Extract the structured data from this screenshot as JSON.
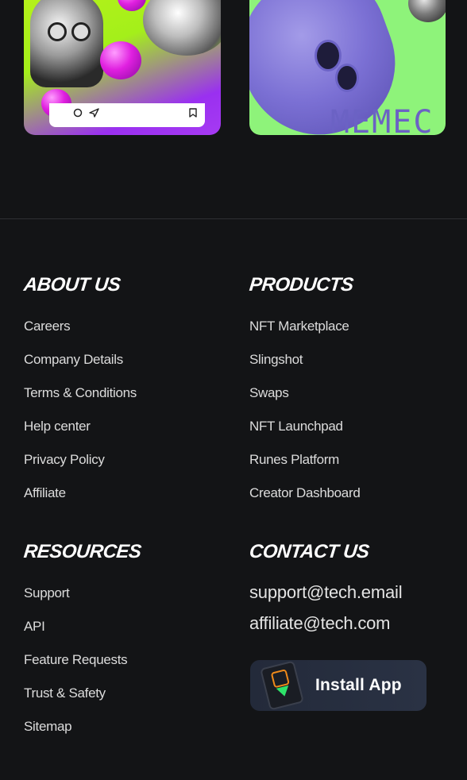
{
  "cards": {
    "right_card_text": "MEMEC"
  },
  "about": {
    "heading": "ABOUT US",
    "links": [
      "Careers",
      "Company Details",
      "Terms & Conditions",
      "Help center",
      "Privacy Policy",
      "Affiliate"
    ]
  },
  "products": {
    "heading": "PRODUCTS",
    "links": [
      "NFT Marketplace",
      "Slingshot",
      "Swaps",
      "NFT Launchpad",
      "Runes Platform",
      "Creator Dashboard"
    ]
  },
  "resources": {
    "heading": "RESOURCES",
    "links": [
      "Support",
      "API",
      "Feature Requests",
      "Trust & Safety",
      "Sitemap"
    ]
  },
  "contact": {
    "heading": "CONTACT US",
    "emails": [
      "support@tech.email",
      "affiliate@tech.com"
    ],
    "install_label": "Install App"
  },
  "colors": {
    "background": "#131416",
    "heading": "#ffffff",
    "link": "#dcdcdc",
    "install_button": "#232a3a"
  },
  "icons": {
    "comment": "comment-icon",
    "send": "send-icon",
    "bookmark": "bookmark-icon",
    "install": "app-download-icon"
  }
}
